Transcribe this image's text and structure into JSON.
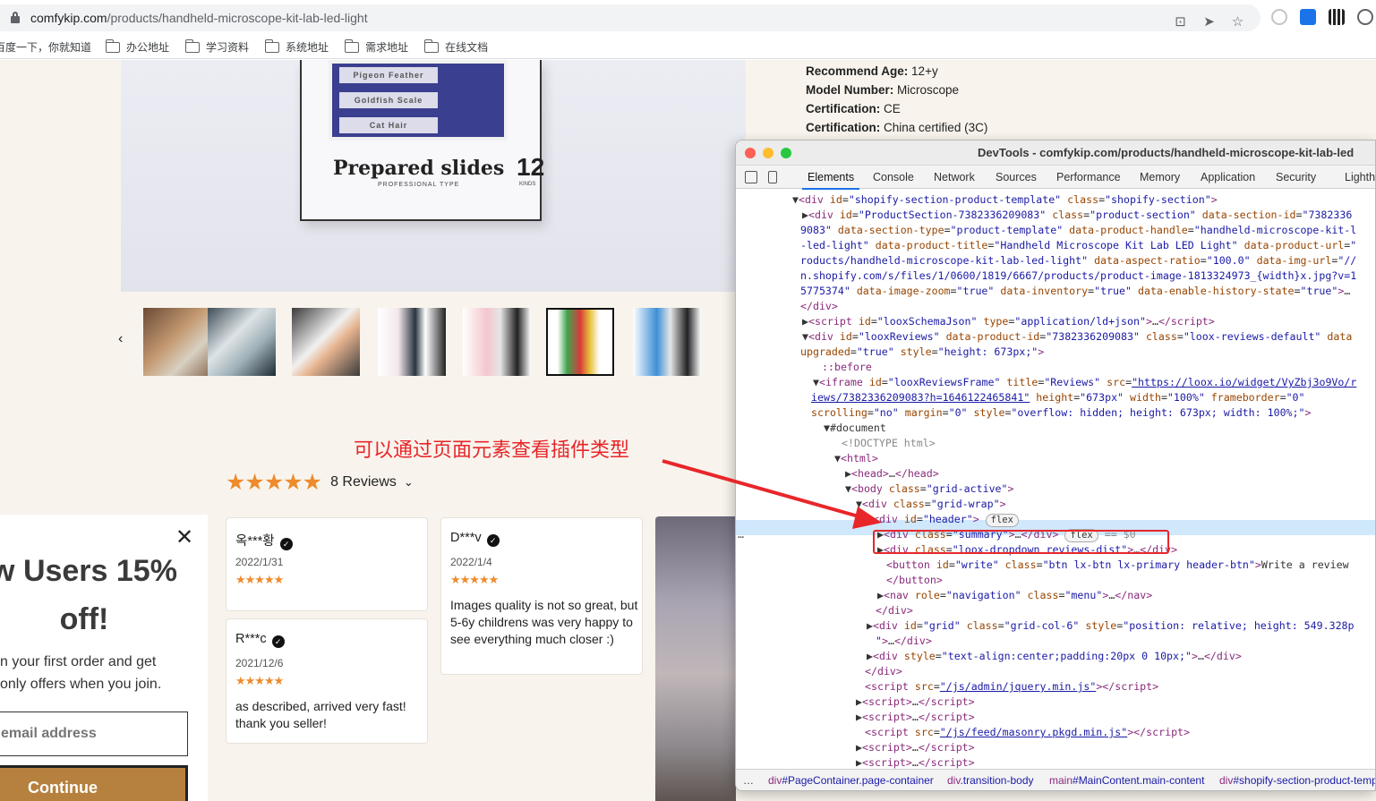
{
  "browser": {
    "url_domain": "comfykip.com",
    "url_path": "/products/handheld-microscope-kit-lab-led-light",
    "bookmarks": [
      "百度一下，你就知道",
      "办公地址",
      "学习资料",
      "系统地址",
      "需求地址",
      "在线文档"
    ]
  },
  "product": {
    "box_title": "Prepared slides",
    "box_subtitle": "PROFESSIONAL TYPE",
    "box_number": "12",
    "box_kinds": "KINDS",
    "slides": [
      "Pigeon Feather",
      "Goldfish Scale",
      "Cat Hair"
    ],
    "specs": [
      {
        "label": "Recommend Age:",
        "value": "12+y"
      },
      {
        "label": "Model Number:",
        "value": "Microscope"
      },
      {
        "label": "Certification:",
        "value": "CE"
      },
      {
        "label": "Certification:",
        "value": "China certified (3C)"
      }
    ],
    "thumb_prev": "‹"
  },
  "annotation": "可以通过页面元素查看插件类型",
  "reviews": {
    "rating_stars": "★★★★★",
    "count_label": "8 Reviews",
    "chevron": "⌄",
    "items": [
      {
        "name": "옥***황",
        "date": "2022/1/31",
        "stars": "★★★★★",
        "text": ""
      },
      {
        "name": "D***v",
        "date": "2022/1/4",
        "stars": "★★★★★",
        "text": "Images quality is not so great, but 5-6y childrens was very happy to see everything much closer :)"
      },
      {
        "name": "R***c",
        "date": "2021/12/6",
        "stars": "★★★★★",
        "text": "as described, arrived very fast! thank you seller!"
      }
    ]
  },
  "popup": {
    "close": "✕",
    "heading": "w Users 15% off!",
    "text_line1": "n your first order and get",
    "text_line2": "only offers when you join.",
    "email_placeholder": "email address",
    "button": "Continue"
  },
  "devtools": {
    "title": "DevTools - comfykip.com/products/handheld-microscope-kit-lab-led",
    "tabs": [
      "Elements",
      "Console",
      "Network",
      "Sources",
      "Performance",
      "Memory",
      "Application",
      "Security",
      "Lighthouse"
    ],
    "breadcrumbs": [
      {
        "el": "div",
        "id": "#PageContainer.page-container"
      },
      {
        "el": "div",
        "id": ".transition-body"
      },
      {
        "el": "main",
        "id": "#MainContent.main-content"
      },
      {
        "el": "div",
        "id": "#shopify-section-product-template"
      }
    ],
    "selected_marker": "== $0",
    "flex_badge": "flex",
    "ellipsis": "…"
  },
  "colors": {
    "accent": "#ee8b2c",
    "annotation_red": "#e8262a",
    "button_brown": "#b6813e",
    "page_bg": "#f8f4ed"
  }
}
